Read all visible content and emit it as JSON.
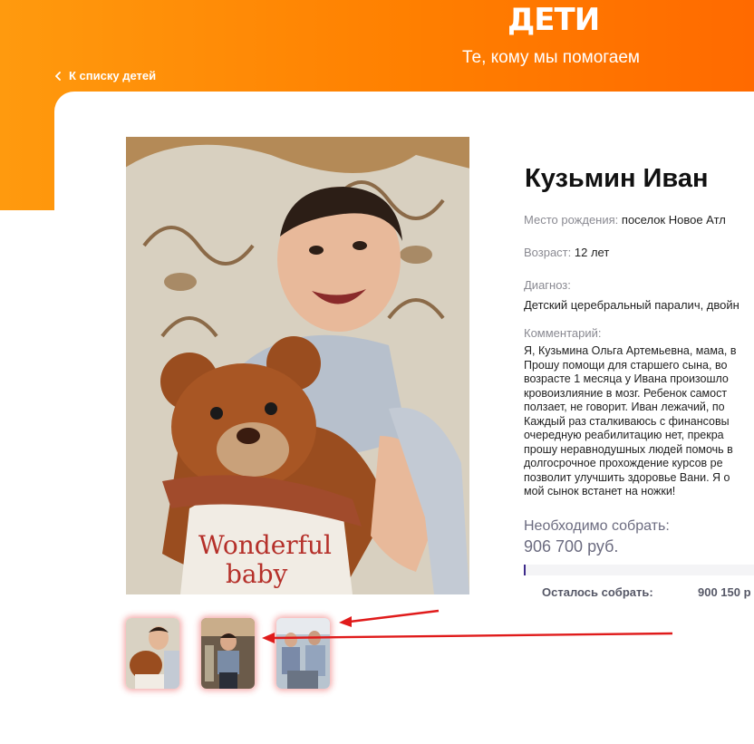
{
  "header": {
    "logo": "ДЕТИ",
    "subtitle": "Те, кому мы помогаем",
    "back_link": "К списку детей"
  },
  "profile": {
    "name": "Кузьмин Иван",
    "birthplace_label": "Место рождения:",
    "birthplace_value": "поселок Новое Атл",
    "age_label": "Возраст:",
    "age_value": "12 лет",
    "diagnosis_label": "Диагноз:",
    "diagnosis_value": "Детский церебральный паралич, двойн",
    "comment_label": "Комментарий:",
    "comment_lines": [
      "Я, Кузьмина Ольга Артемьевна, мама, в",
      "Прошу помощи для старшего сына, во",
      "возрасте 1 месяца у Ивана произошло",
      "кровоизлияние в мозг. Ребенок самост",
      "ползает, не говорит. Иван лежачий, по",
      "Каждый раз сталкиваюсь с финансовы",
      "очередную реабилитацию нет, прекра",
      "прошу неравнодушных людей помочь в",
      "долгосрочное прохождение курсов ре",
      "позволит улучшить здоровье Вани. Я о",
      "мой сынок встанет на ножки!"
    ]
  },
  "fundraising": {
    "need_label": "Необходимо собрать:",
    "need_value": "906 700 руб.",
    "progress_fraction": 0.007,
    "remaining_label": "Осталось собрать:",
    "remaining_value": "900 150 р"
  },
  "photo": {
    "shirt_line1": "Wonderful",
    "shirt_line2": "baby"
  },
  "colors": {
    "accent": "#ff8000",
    "progress": "#3d2a8a",
    "annotation": "#e01b1b"
  }
}
